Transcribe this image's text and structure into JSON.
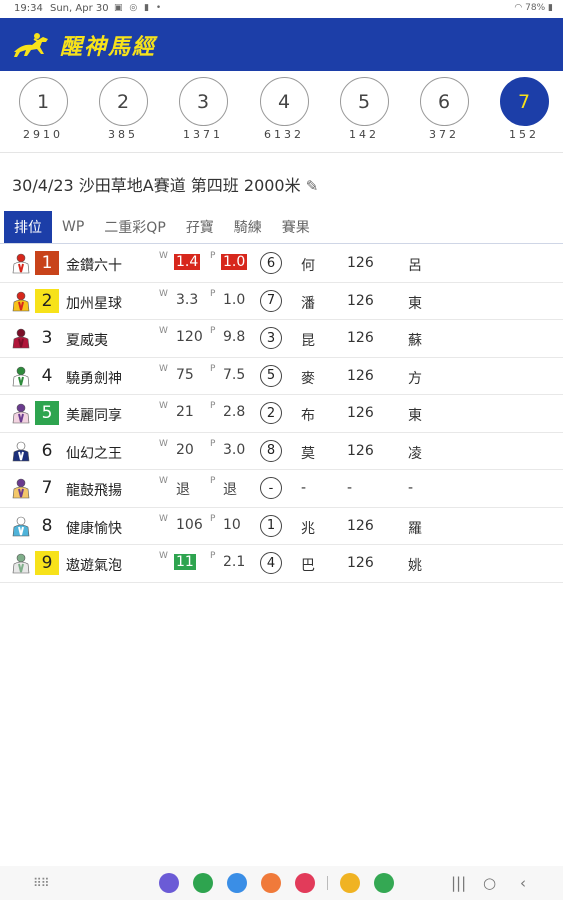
{
  "status_bar": {
    "time": "19:34",
    "date": "Sun, Apr 30",
    "right": "78%"
  },
  "header": {
    "title": "醒神馬經"
  },
  "races": [
    {
      "number": "1",
      "count": "2910",
      "active": false
    },
    {
      "number": "2",
      "count": "385",
      "active": false
    },
    {
      "number": "3",
      "count": "1371",
      "active": false
    },
    {
      "number": "4",
      "count": "6132",
      "active": false
    },
    {
      "number": "5",
      "count": "142",
      "active": false
    },
    {
      "number": "6",
      "count": "372",
      "active": false
    },
    {
      "number": "7",
      "count": "152",
      "active": true
    }
  ],
  "race_info": {
    "text": "30/4/23 沙田草地A賽道 第四班 2000米"
  },
  "tabs": [
    {
      "label": "排位",
      "active": true
    },
    {
      "label": "WP",
      "active": false
    },
    {
      "label": "二重彩QP",
      "active": false
    },
    {
      "label": "孖寶",
      "active": false
    },
    {
      "label": "騎練",
      "active": false
    },
    {
      "label": "賽果",
      "active": false
    }
  ],
  "labels": {
    "w": "W",
    "p": "P"
  },
  "runners": [
    {
      "no": "1",
      "no_style": "red",
      "name": "金鑽六十",
      "win": "1.4",
      "win_style": "red",
      "place": "1.0",
      "place_style": "red",
      "draw": "6",
      "jockey": "何",
      "weight": "126",
      "trainer": "呂",
      "silk_colors": [
        "#ffffff",
        "#d7271c"
      ]
    },
    {
      "no": "2",
      "no_style": "yellow",
      "name": "加州星球",
      "win": "3.3",
      "win_style": "",
      "place": "1.0",
      "place_style": "",
      "draw": "7",
      "jockey": "潘",
      "weight": "126",
      "trainer": "東",
      "silk_colors": [
        "#f7c21a",
        "#d7271c"
      ]
    },
    {
      "no": "3",
      "no_style": "",
      "name": "夏威夷",
      "win": "120",
      "win_style": "",
      "place": "9.8",
      "place_style": "",
      "draw": "3",
      "jockey": "昆",
      "weight": "126",
      "trainer": "蘇",
      "silk_colors": [
        "#b0163a",
        "#7a0f28"
      ]
    },
    {
      "no": "4",
      "no_style": "",
      "name": "驍勇劍神",
      "win": "75",
      "win_style": "",
      "place": "7.5",
      "place_style": "",
      "draw": "5",
      "jockey": "麥",
      "weight": "126",
      "trainer": "方",
      "silk_colors": [
        "#ffffff",
        "#2e8b3c"
      ]
    },
    {
      "no": "5",
      "no_style": "green",
      "name": "美麗同享",
      "win": "21",
      "win_style": "",
      "place": "2.8",
      "place_style": "",
      "draw": "2",
      "jockey": "布",
      "weight": "126",
      "trainer": "東",
      "silk_colors": [
        "#f2d3e0",
        "#6a3b8e"
      ]
    },
    {
      "no": "6",
      "no_style": "",
      "name": "仙幻之王",
      "win": "20",
      "win_style": "",
      "place": "3.0",
      "place_style": "",
      "draw": "8",
      "jockey": "莫",
      "weight": "126",
      "trainer": "凌",
      "silk_colors": [
        "#1c2f7a",
        "#ffffff"
      ]
    },
    {
      "no": "7",
      "no_style": "",
      "name": "龍鼓飛揚",
      "win": "退",
      "win_style": "",
      "place": "退",
      "place_style": "",
      "draw": "-",
      "jockey": "-",
      "weight": "-",
      "trainer": "-",
      "silk_colors": [
        "#f3c76a",
        "#6a3b8e"
      ]
    },
    {
      "no": "8",
      "no_style": "",
      "name": "健康愉快",
      "win": "106",
      "win_style": "",
      "place": "10",
      "place_style": "",
      "draw": "1",
      "jockey": "兆",
      "weight": "126",
      "trainer": "羅",
      "silk_colors": [
        "#4fb3d9",
        "#ffffff"
      ]
    },
    {
      "no": "9",
      "no_style": "yellow",
      "name": "遨遊氣泡",
      "win": "11",
      "win_style": "green",
      "place": "2.1",
      "place_style": "",
      "draw": "4",
      "jockey": "巴",
      "weight": "126",
      "trainer": "姚",
      "silk_colors": [
        "#e8e8e8",
        "#7fae8a"
      ]
    }
  ],
  "dock_apps": [
    {
      "name": "bixby-app",
      "color": "#6b5bd6"
    },
    {
      "name": "phone-app",
      "color": "#2ea44f"
    },
    {
      "name": "messages-app",
      "color": "#3a8ee6"
    },
    {
      "name": "contacts-app",
      "color": "#f07a3a"
    },
    {
      "name": "screen-recorder-app",
      "color": "#e23b5a"
    },
    {
      "name": "photos-app",
      "color": "#f0b323"
    },
    {
      "name": "play-store-app",
      "color": "#34a853"
    }
  ]
}
